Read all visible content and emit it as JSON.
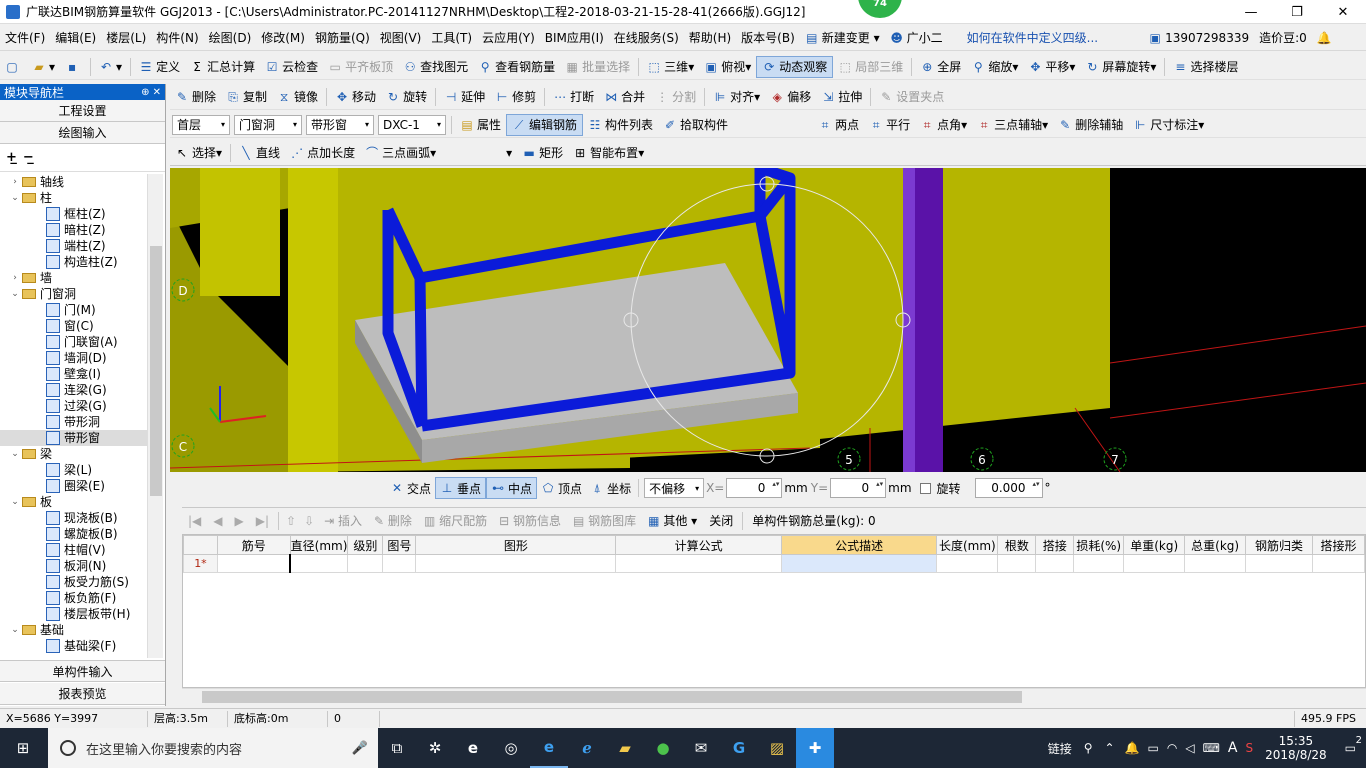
{
  "window": {
    "title": "广联达BIM钢筋算量软件 GGJ2013 - [C:\\Users\\Administrator.PC-20141127NRHM\\Desktop\\工程2-2018-03-21-15-28-41(2666版).GGJ12]",
    "badge": "74",
    "minimize": "—",
    "maximize": "❐",
    "close": "✕"
  },
  "menu": {
    "items": [
      "文件(F)",
      "编辑(E)",
      "楼层(L)",
      "构件(N)",
      "绘图(D)",
      "修改(M)",
      "钢筋量(Q)",
      "视图(V)",
      "工具(T)",
      "云应用(Y)",
      "BIM应用(I)",
      "在线服务(S)",
      "帮助(H)",
      "版本号(B)"
    ],
    "new_change": "新建变更",
    "assistant": "广小二",
    "hint": "如何在软件中定义四级...",
    "phone": "13907298339",
    "beans": "造价豆:0"
  },
  "toolbar1": {
    "define": "定义",
    "sum_calc": "汇总计算",
    "cloud_check": "云检查",
    "flat_top": "平齐板顶",
    "find_elem": "查找图元",
    "view_rebar": "查看钢筋量",
    "batch_select": "批量选择",
    "three_d": "三维",
    "top_view": "俯视",
    "dynamic_view": "动态观察",
    "local_3d": "局部三维",
    "full_screen": "全屏",
    "zoom": "缩放",
    "pan": "平移",
    "screen_rotate": "屏幕旋转",
    "select_floor": "选择楼层"
  },
  "toolbar2": {
    "delete": "删除",
    "copy": "复制",
    "mirror": "镜像",
    "move": "移动",
    "rotate": "旋转",
    "extend": "延伸",
    "trim": "修剪",
    "break": "打断",
    "merge": "合并",
    "split": "分割",
    "align": "对齐",
    "offset": "偏移",
    "stretch": "拉伸",
    "set_grip": "设置夹点"
  },
  "toolbar3": {
    "floor": "首层",
    "category": "门窗洞",
    "type": "带形窗",
    "component": "DXC-1",
    "property": "属性",
    "edit_rebar": "编辑钢筋",
    "component_list": "构件列表",
    "pick_component": "拾取构件",
    "two_points": "两点",
    "parallel": "平行",
    "point_angle": "点角",
    "three_point_axis": "三点辅轴",
    "delete_axis": "删除辅轴",
    "dimension": "尺寸标注"
  },
  "toolbar4": {
    "select": "选择",
    "line": "直线",
    "point_length": "点加长度",
    "three_point_arc": "三点画弧",
    "rect": "矩形",
    "smart_layout": "智能布置"
  },
  "left_panel": {
    "header": "模块导航栏",
    "pin": "⊕ ✕",
    "project_settings": "工程设置",
    "drawing_input": "绘图输入",
    "single_input": "单构件输入",
    "report_preview": "报表预览",
    "tree": [
      {
        "label": "轴线",
        "level": 0,
        "exp": "›"
      },
      {
        "label": "柱",
        "level": 0,
        "exp": "⌄"
      },
      {
        "label": "框柱(Z)",
        "level": 1
      },
      {
        "label": "暗柱(Z)",
        "level": 1
      },
      {
        "label": "端柱(Z)",
        "level": 1
      },
      {
        "label": "构造柱(Z)",
        "level": 1
      },
      {
        "label": "墙",
        "level": 0,
        "exp": "›"
      },
      {
        "label": "门窗洞",
        "level": 0,
        "exp": "⌄"
      },
      {
        "label": "门(M)",
        "level": 1
      },
      {
        "label": "窗(C)",
        "level": 1
      },
      {
        "label": "门联窗(A)",
        "level": 1
      },
      {
        "label": "墙洞(D)",
        "level": 1
      },
      {
        "label": "壁龛(I)",
        "level": 1
      },
      {
        "label": "连梁(G)",
        "level": 1
      },
      {
        "label": "过梁(G)",
        "level": 1
      },
      {
        "label": "带形洞",
        "level": 1
      },
      {
        "label": "带形窗",
        "level": 1,
        "selected": true
      },
      {
        "label": "梁",
        "level": 0,
        "exp": "⌄"
      },
      {
        "label": "梁(L)",
        "level": 1
      },
      {
        "label": "圈梁(E)",
        "level": 1
      },
      {
        "label": "板",
        "level": 0,
        "exp": "⌄"
      },
      {
        "label": "现浇板(B)",
        "level": 1
      },
      {
        "label": "螺旋板(B)",
        "level": 1
      },
      {
        "label": "柱帽(V)",
        "level": 1
      },
      {
        "label": "板洞(N)",
        "level": 1
      },
      {
        "label": "板受力筋(S)",
        "level": 1
      },
      {
        "label": "板负筋(F)",
        "level": 1
      },
      {
        "label": "楼层板带(H)",
        "level": 1
      },
      {
        "label": "基础",
        "level": 0,
        "exp": "⌄"
      },
      {
        "label": "基础梁(F)",
        "level": 1
      }
    ]
  },
  "view3d": {
    "axes": {
      "d": "D",
      "c": "C",
      "n5": "5",
      "n6": "6",
      "n7": "7"
    },
    "colors": {
      "wall": "#b5b500",
      "rebar": "#0b1bd9",
      "column": "#5a12a8",
      "slab": "#bdbdbd"
    }
  },
  "snapbar": {
    "intersection": "交点",
    "perpendicular": "垂点",
    "midpoint": "中点",
    "vertex": "顶点",
    "coordinate": "坐标",
    "no_offset": "不偏移",
    "x_label": "X=",
    "x_value": "0",
    "y_label": "Y=",
    "y_value": "0",
    "unit": "mm",
    "rotate": "旋转",
    "rotate_value": "0.000",
    "deg": "°"
  },
  "grid_toolbar": {
    "insert": "插入",
    "delete": "删除",
    "scale_rebar": "缩尺配筋",
    "rebar_info": "钢筋信息",
    "rebar_lib": "钢筋图库",
    "other": "其他",
    "close": "关闭",
    "total_weight": "单构件钢筋总量(kg): 0"
  },
  "grid": {
    "columns": [
      "筋号",
      "直径(mm)",
      "级别",
      "图号",
      "图形",
      "计算公式",
      "公式描述",
      "长度(mm)",
      "根数",
      "搭接",
      "损耗(%)",
      "单重(kg)",
      "总重(kg)",
      "钢筋归类",
      "搭接形"
    ],
    "row_label": "1*"
  },
  "statusbar": {
    "coords": "X=5686 Y=3997",
    "floor_height": "层高:3.5m",
    "base_height": "底标高:0m",
    "zero": "0",
    "fps": "495.9 FPS"
  },
  "taskbar": {
    "search_placeholder": "在这里输入你要搜索的内容",
    "link": "链接",
    "ime": "A",
    "time": "15:35",
    "date": "2018/8/28",
    "notif": "2"
  }
}
